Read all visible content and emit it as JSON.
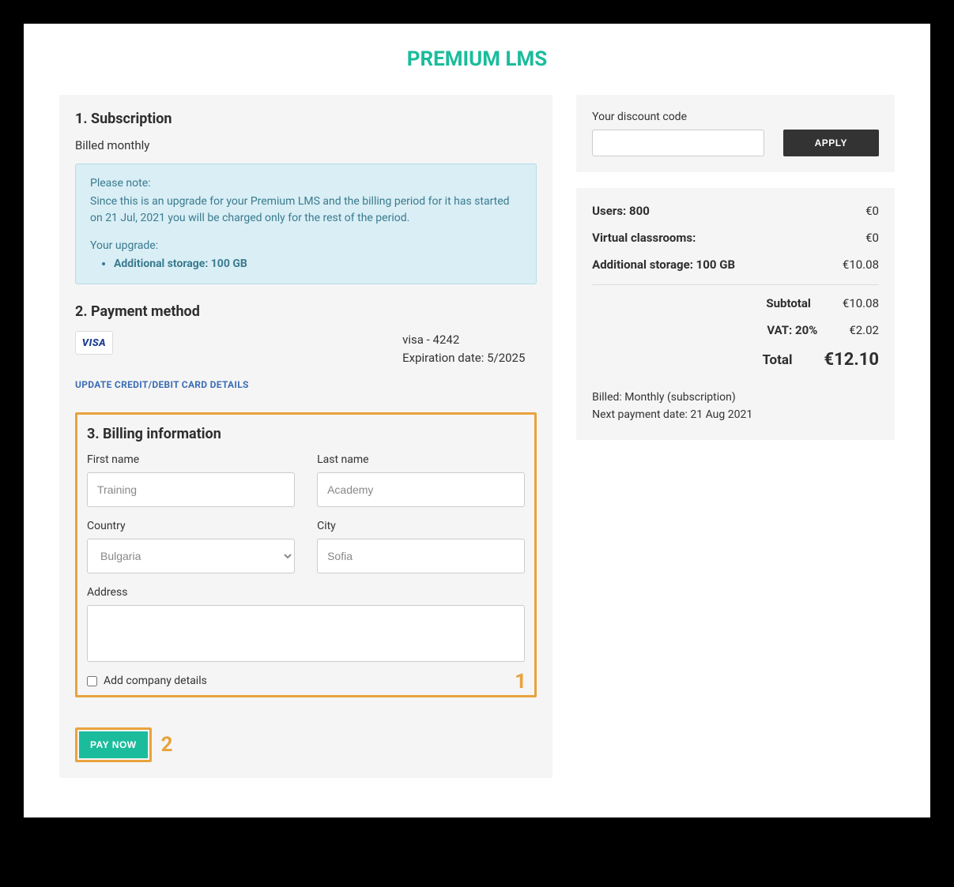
{
  "brand": "PREMIUM LMS",
  "subscription": {
    "heading": "1. Subscription",
    "billed": "Billed monthly",
    "note_title": "Please note:",
    "note_body": "Since this is an upgrade for your Premium LMS and the billing period for it has started on 21 Jul, 2021 you will be charged only for the rest of the period.",
    "upgrade_label": "Your upgrade:",
    "upgrade_item": "Additional storage: 100 GB"
  },
  "payment": {
    "heading": "2. Payment method",
    "card_logo": "VISA",
    "card_text": "visa - 4242",
    "exp_label": "Expiration date: 5/2025",
    "update_link": "UPDATE CREDIT/DEBIT CARD DETAILS"
  },
  "billing": {
    "heading": "3. Billing information",
    "first_name_label": "First name",
    "first_name_value": "Training",
    "last_name_label": "Last name",
    "last_name_value": "Academy",
    "country_label": "Country",
    "country_value": "Bulgaria",
    "city_label": "City",
    "city_value": "Sofia",
    "address_label": "Address",
    "address_value": "",
    "company_checkbox": "Add company details",
    "step_badge": "1"
  },
  "pay": {
    "button": "PAY NOW",
    "step_badge": "2"
  },
  "discount": {
    "label": "Your discount code",
    "apply": "APPLY"
  },
  "summary": {
    "users_label": "Users: 800",
    "users_value": "€0",
    "rooms_label": "Virtual classrooms:",
    "rooms_value": "€0",
    "storage_label": "Additional storage: 100 GB",
    "storage_value": "€10.08",
    "subtotal_label": "Subtotal",
    "subtotal_value": "€10.08",
    "vat_label": "VAT: 20%",
    "vat_value": "€2.02",
    "total_label": "Total",
    "total_value": "€12.10",
    "billed_text": "Billed: Monthly (subscription)",
    "next_payment": "Next payment date: 21 Aug 2021"
  }
}
